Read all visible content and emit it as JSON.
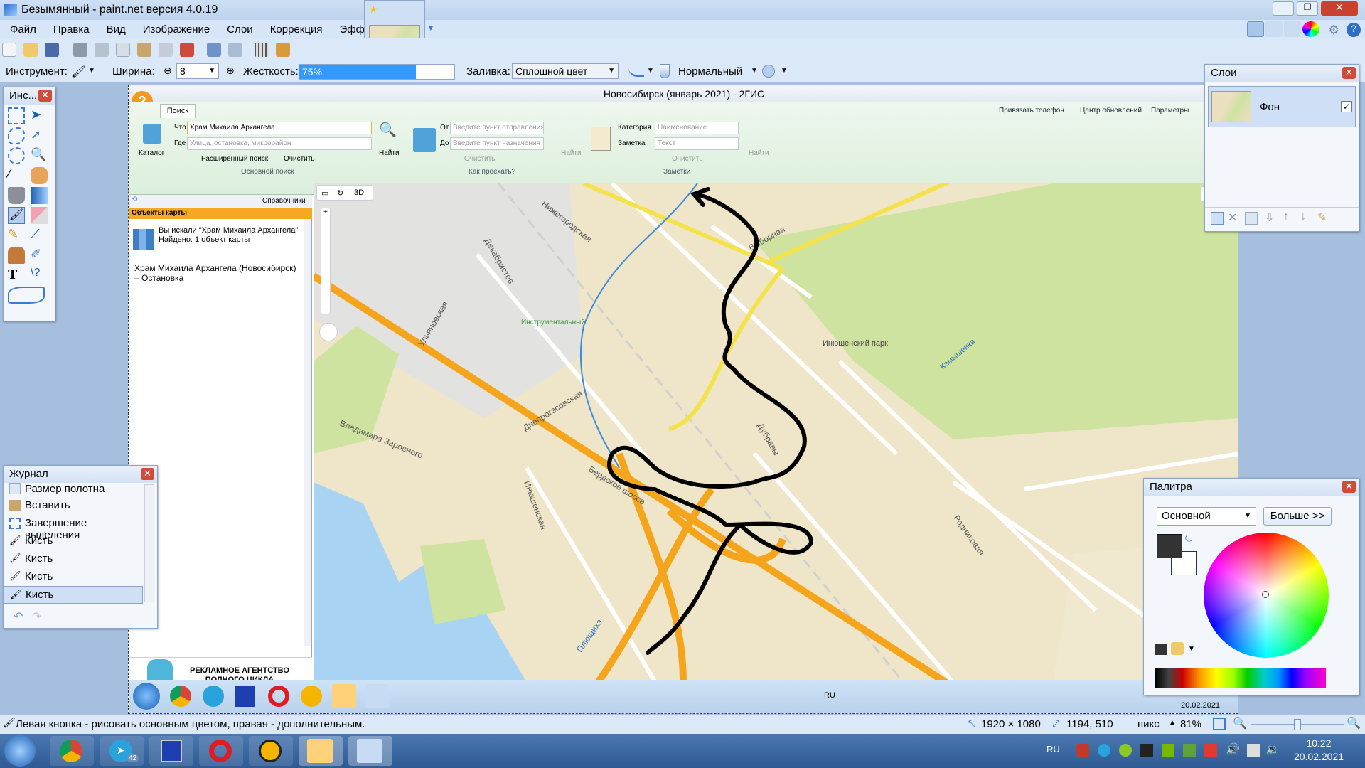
{
  "window": {
    "title": "Безымянный - paint.net версия 4.0.19",
    "controls": [
      "minimize-icon",
      "restore-icon",
      "close-icon"
    ]
  },
  "menu": [
    "Файл",
    "Правка",
    "Вид",
    "Изображение",
    "Слои",
    "Коррекция",
    "Эффекты"
  ],
  "toolbar2": {
    "tool_label": "Инструмент:",
    "width_label": "Ширина:",
    "width_value": "8",
    "hardness_label": "Жесткость:",
    "hardness_value": "75%",
    "hardness_fraction": 0.75,
    "fill_label": "Заливка:",
    "fill_value": "Сплошной цвет",
    "blend_value": "Нормальный"
  },
  "tools_panel": {
    "title": "Инс..."
  },
  "layers_panel": {
    "title": "Слои",
    "layers": [
      {
        "name": "Фон",
        "visible": true
      }
    ]
  },
  "history_panel": {
    "title": "Журнал",
    "items": [
      "Размер полотна",
      "Вставить",
      "Завершение выделения",
      "Кисть",
      "Кисть",
      "Кисть",
      "Кисть"
    ]
  },
  "palette_panel": {
    "title": "Палитра",
    "mode": "Основной",
    "more_button": "Больше >>",
    "primary_color": "#333333",
    "secondary_color": "#ffffff"
  },
  "gis": {
    "title": "Новосибирск (январь 2021) - 2ГИС",
    "tab": "Поиск",
    "links": [
      "Привязать телефон",
      "Центр обновлений",
      "Параметры"
    ],
    "catalog": "Каталог",
    "what_label": "Что",
    "what_value": "Храм Михаила Архангела",
    "where_label": "Где",
    "where_placeholder": "Улица, остановка, микрорайон",
    "find": "Найти",
    "advanced": "Расширенный поиск",
    "clear": "Очистить",
    "group_main": "Основной поиск",
    "from_label": "От",
    "from_placeholder": "Введите пункт отправления",
    "to_label": "До",
    "to_placeholder": "Введите пункт назначения",
    "route_clear": "Очистить",
    "route_find": "Найти",
    "group_route": "Как проехать?",
    "category_label": "Категория",
    "category_placeholder": "Наименование",
    "note_label": "Заметка",
    "note_placeholder": "Текст",
    "notes_clear": "Очистить",
    "notes_find": "Найти",
    "group_notes": "Заметки",
    "left_toolbar_label": "Справочники",
    "objects_header": "Объекты карты",
    "search_result_title": "Вы искали \"Храм Михаила Архангела\"",
    "search_result_count": "Найдено: 1 объект карты",
    "result_link": "Храм Михаила Архангела (Новосибирск)",
    "result_suffix": " – Остановка",
    "ad_text_1": "РЕКЛАМНОЕ АГЕНТСТВО",
    "ad_text_2": "ПОЛНОГО ЦИКЛА",
    "map_3d": "3D",
    "map_labels": [
      "Нижегородская",
      "Декабристов",
      "Выборная",
      "Инструментальный",
      "Инюшенский парк",
      "Камышенка",
      "Ульяновская",
      "Днепрогэсовская",
      "Владимира Заровного",
      "Инюшенская",
      "Бердское шоссе",
      "Дубравы",
      "Родниковая",
      "Плющиха"
    ],
    "tray_lang": "RU",
    "tray_date": "20.02.2021"
  },
  "statusbar": {
    "hint": "Левая кнопка - рисовать основным цветом, правая - дополнительным.",
    "image_size": "1920 × 1080",
    "cursor_pos": "1194, 510",
    "units": "пикс",
    "zoom": "81%"
  },
  "taskbar": {
    "lang": "RU",
    "time": "10:22",
    "date": "20.02.2021",
    "telegram_badge": "42"
  },
  "colors": {
    "accent": "#3399ff",
    "road": "#f5a51c",
    "park": "#cfe3a0",
    "water": "#a9d3f3",
    "stroke": "#000000"
  }
}
